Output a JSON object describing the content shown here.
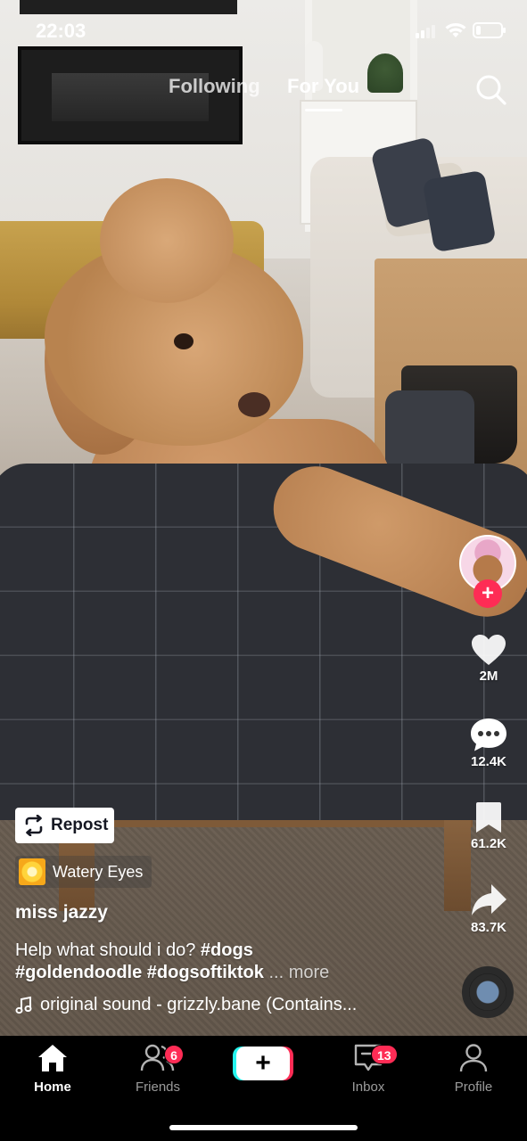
{
  "status_bar": {
    "time": "22:03",
    "battery_level": 0.2
  },
  "top_tabs": {
    "following": "Following",
    "for_you": "For You",
    "active": "for_you"
  },
  "rail": {
    "likes": "2M",
    "comments": "12.4K",
    "saves": "61.2K",
    "shares": "83.7K"
  },
  "repost": {
    "label": "Repost"
  },
  "effect": {
    "label": "Watery Eyes"
  },
  "post": {
    "username": "miss jazzy",
    "caption_text": "Help what should i do?",
    "hashtag_1": "#dogs",
    "hashtag_2": "#goldendoodle",
    "hashtag_3": "#dogsoftiktok",
    "more": "... more",
    "sound": "original sound - grizzly.bane (Contains..."
  },
  "nav": {
    "home": "Home",
    "friends": "Friends",
    "friends_badge": "6",
    "inbox": "Inbox",
    "inbox_badge": "13",
    "profile": "Profile",
    "create": "+"
  },
  "colors": {
    "accent_red": "#fe2c55",
    "accent_cyan": "#25f4ee",
    "nav_bg": "#000000"
  },
  "icons": [
    "search-icon",
    "heart-icon",
    "comment-icon",
    "bookmark-icon",
    "share-icon",
    "repost-icon",
    "music-note-icon",
    "home-icon",
    "friends-icon",
    "inbox-icon",
    "profile-icon",
    "plus-icon"
  ]
}
